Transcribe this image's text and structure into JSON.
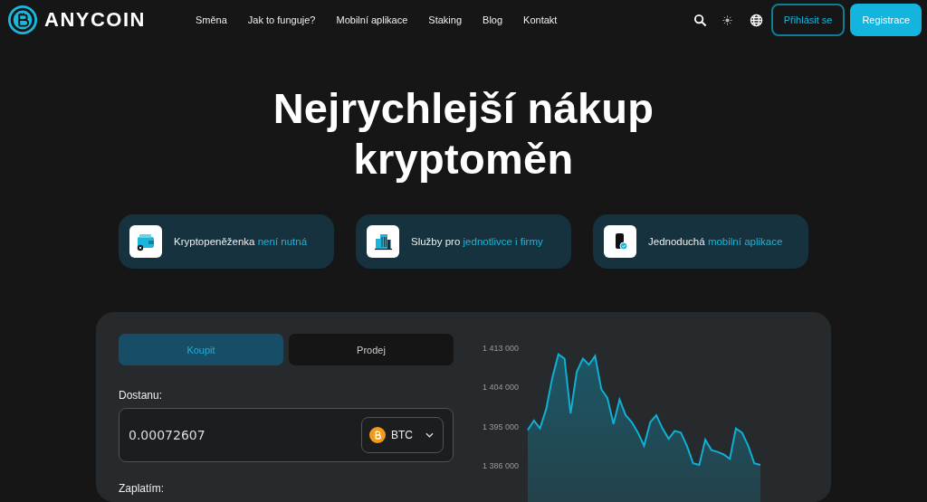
{
  "header": {
    "logo": "ANYCOIN",
    "nav": [
      {
        "label": "Směna"
      },
      {
        "label": "Jak to funguje?"
      },
      {
        "label": "Mobilní aplikace"
      },
      {
        "label": "Staking"
      },
      {
        "label": "Blog"
      },
      {
        "label": "Kontakt"
      }
    ],
    "login": "Přihlásit se",
    "register": "Registrace"
  },
  "hero": {
    "title": "Nejrychlejší nákup kryptoměn"
  },
  "features": [
    {
      "kind": "wallet",
      "text": "Kryptopeněženka",
      "highlight": "není nutná"
    },
    {
      "kind": "building",
      "text": "Služby pro",
      "highlight": "jednotlivce i firmy"
    },
    {
      "kind": "phone",
      "text": "Jednoduchá",
      "highlight": "mobilní aplikace"
    }
  ],
  "exchange": {
    "tabs": [
      {
        "label": "Koupit",
        "selected": true
      },
      {
        "label": "Prodej",
        "selected": false
      }
    ],
    "receive_label": "Dostanu:",
    "receive_value": "0.00072607",
    "currency": "BTC",
    "pay_label": "Zaplatím:",
    "chart_data": {
      "type": "area",
      "categories": [
        null,
        null,
        null,
        null,
        null,
        null,
        null,
        null,
        null,
        null,
        null,
        null,
        null,
        null,
        null,
        null,
        null,
        null,
        null,
        null,
        null,
        null,
        null,
        null,
        null,
        null,
        null,
        null,
        null,
        null,
        null,
        null,
        null,
        null,
        null,
        null,
        null,
        null,
        null
      ],
      "ylim": [
        1386000,
        1413000
      ],
      "yticks": [
        {
          "value": 1413000,
          "label": "1 413 000"
        },
        {
          "value": 1404000,
          "label": "1 404 000"
        },
        {
          "value": 1395000,
          "label": "1 395 000"
        },
        {
          "value": 1386000,
          "label": "1 386 000"
        }
      ],
      "series": [
        {
          "color": "#0fb0d3",
          "values": [
            1394000,
            1396200,
            1394400,
            1398800,
            1406000,
            1411400,
            1410400,
            1397800,
            1407400,
            1410400,
            1409000,
            1411000,
            1403400,
            1401400,
            1395400,
            1401000,
            1397400,
            1395800,
            1393400,
            1390400,
            1395800,
            1397400,
            1394400,
            1392000,
            1393800,
            1393400,
            1390400,
            1386400,
            1386000,
            1391800,
            1389400,
            1389000,
            1388400,
            1387400,
            1394400,
            1393400,
            1390400,
            1386400,
            1386000
          ]
        }
      ]
    }
  }
}
